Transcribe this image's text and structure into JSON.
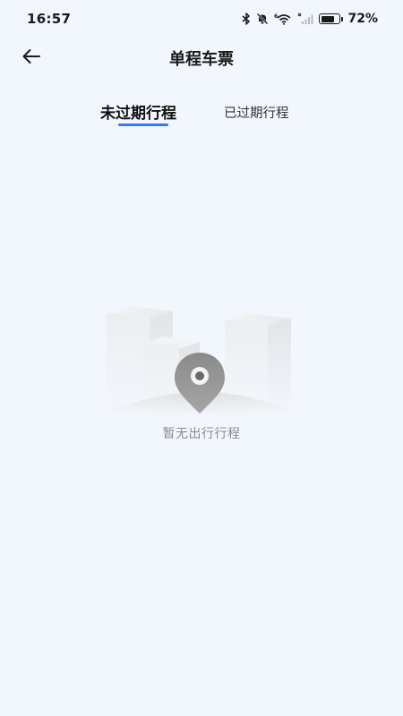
{
  "status_bar": {
    "time": "16:57",
    "battery_percent": "72%",
    "battery_level": 0.72,
    "icons": [
      "bluetooth-icon",
      "mute-icon",
      "wifi-6-icon",
      "signal-no-service-icon",
      "battery-icon"
    ]
  },
  "nav": {
    "title": "单程车票",
    "back_icon": "arrow-left-icon"
  },
  "tabs": [
    {
      "label": "未过期行程",
      "active": true
    },
    {
      "label": "已过期行程",
      "active": false
    }
  ],
  "empty_state": {
    "message": "暂无出行行程",
    "illustration": "map-pin-buildings-illustration"
  },
  "colors": {
    "background": "#f2f7fd",
    "accent": "#2f7cf6",
    "text_primary": "#1a1a1a",
    "text_muted": "#8a8a8a"
  }
}
